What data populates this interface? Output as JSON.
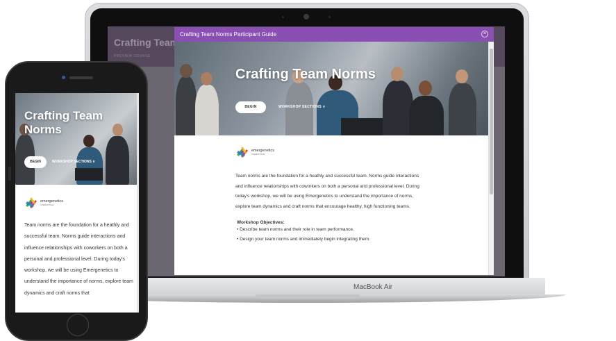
{
  "background_page": {
    "title": "Crafting Team",
    "subtitle": "PREVIEW COURSE"
  },
  "modal": {
    "header_title": "Crafting Team Norms Participant Guide",
    "close_icon": "close-circle-icon",
    "hero": {
      "title": "Crafting Team Norms",
      "begin_label": "BEGIN",
      "sections_label": "WORKSHOP SECTIONS ∨"
    },
    "logo": {
      "name": "emergenetics",
      "tagline": "INTERNATIONAL"
    },
    "intro": "Team norms are the foundation for a heathly and successful team.  Norms guide interactions and influence relationships with coworkers on both a personal and professional level.  During today's workshop, we will be using Emergenetics to understand the importance of norms, explore team dynamics and craft norms that encourage healthy, high functioning teams.",
    "objectives_title": "Workshop Objectives:",
    "objectives": [
      "• Describe team norms and their role in team performance.",
      "• Design your team norms and immediately begin integrating them."
    ]
  },
  "laptop": {
    "brand": "MacBook Air"
  },
  "phone": {
    "hero_title": "Crafting Team Norms",
    "begin_label": "BEGIN",
    "sections_label": "WORKSHOP SECTIONS ∨",
    "logo_name": "emergenetics",
    "logo_tagline": "INTERNATIONAL",
    "intro": "Team norms are the foundation for a heathly and successful team.  Norms guide interactions and influence relationships with coworkers on both a personal and professional level.  During today's workshop, we will be using Emergenetics to understand the importance of norms, explore team dynamics and craft norms that"
  },
  "colors": {
    "modal_header": "#8a4fb2",
    "background_overlay": "#4a3d52",
    "logo_colors": [
      "#3bb24a",
      "#e7412c",
      "#2a7fc1",
      "#f5b41a",
      "#8e4ba0"
    ]
  }
}
